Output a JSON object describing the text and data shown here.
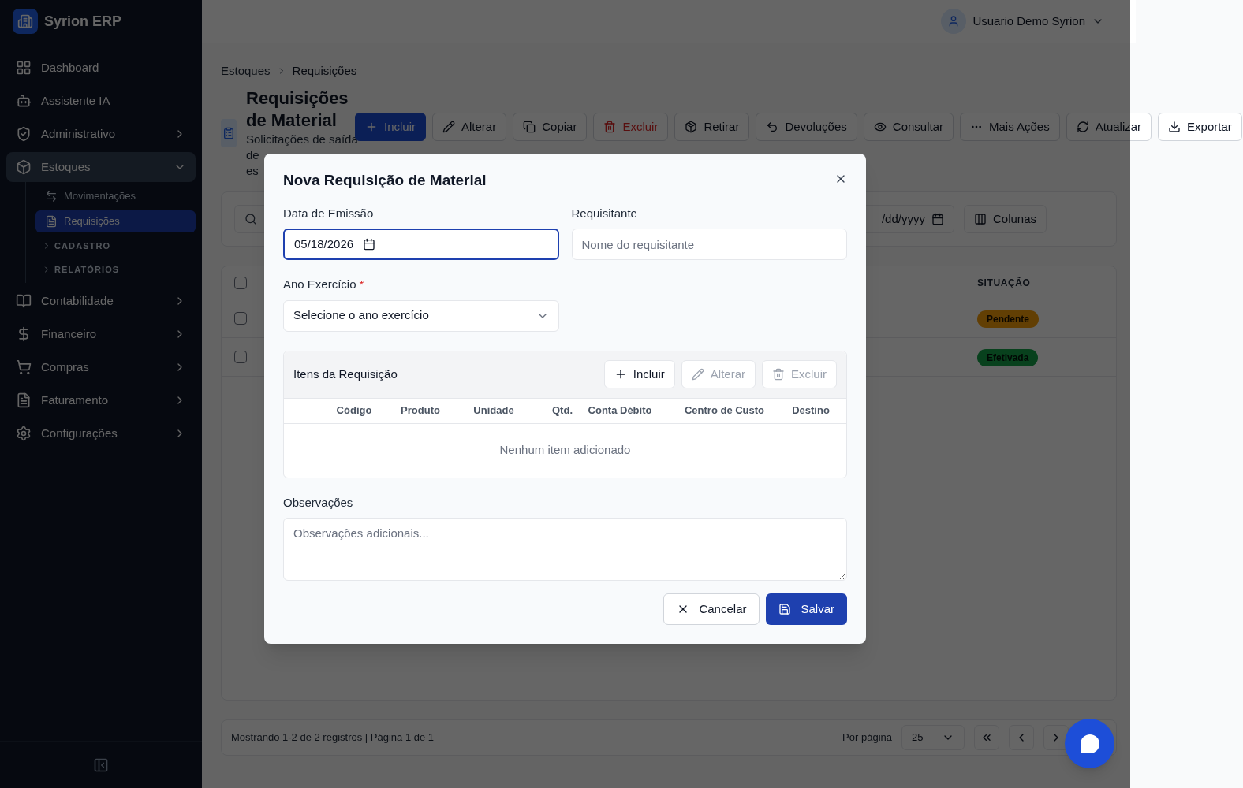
{
  "app": {
    "name": "Syrion ERP"
  },
  "sidebar": {
    "items": [
      {
        "label": "Dashboard",
        "expanded": false
      },
      {
        "label": "Assistente IA",
        "expanded": false
      },
      {
        "label": "Administrativo",
        "expanded": false
      },
      {
        "label": "Estoques",
        "expanded": true,
        "children": [
          {
            "label": "Movimentações",
            "kind": "link",
            "selected": false
          },
          {
            "label": "Requisições",
            "kind": "link",
            "selected": true
          },
          {
            "label": "CADASTRO",
            "kind": "section"
          },
          {
            "label": "RELATÓRIOS",
            "kind": "section"
          }
        ]
      },
      {
        "label": "Contabilidade",
        "expanded": false
      },
      {
        "label": "Financeiro",
        "expanded": false
      },
      {
        "label": "Compras",
        "expanded": false
      },
      {
        "label": "Faturamento",
        "expanded": false
      },
      {
        "label": "Configurações",
        "expanded": false
      }
    ]
  },
  "header": {
    "user": "Usuario Demo Syrion"
  },
  "breadcrumb": [
    "Estoques",
    "Requisições"
  ],
  "page": {
    "title_lines": [
      "Requisições",
      "de Material"
    ],
    "subtitle_lines": [
      "Solicitações de saída",
      "de",
      "es"
    ]
  },
  "toolbar": [
    {
      "label": "Incluir",
      "kind": "primary"
    },
    {
      "label": "Alterar",
      "kind": "default"
    },
    {
      "label": "Copiar",
      "kind": "default"
    },
    {
      "label": "Excluir",
      "kind": "danger"
    },
    {
      "label": "Retirar",
      "kind": "default"
    },
    {
      "label": "Devoluções",
      "kind": "default"
    },
    {
      "label": "Consultar",
      "kind": "default"
    },
    {
      "label": "Mais Ações",
      "kind": "default"
    },
    {
      "label": "Atualizar",
      "kind": "default"
    },
    {
      "label": "Exportar",
      "kind": "default"
    }
  ],
  "filters": {
    "date_value": "/dd/yyyy",
    "columns_button": "Colunas"
  },
  "table": {
    "status_header": "SITUAÇÃO",
    "header_checked": false,
    "rows": [
      {
        "checked": false,
        "status": "Pendente",
        "kind": "pending"
      },
      {
        "checked": false,
        "status": "Efetivada",
        "kind": "done"
      }
    ]
  },
  "footer": {
    "summary": "Mostrando 1-2 de 2 registros | Página 1 de 1",
    "per_page_label": "Por página",
    "per_page": "25"
  },
  "dialog": {
    "title": "Nova Requisição de Material",
    "date_label": "Data de Emissão",
    "date_value": "05/18/2026",
    "requester_label": "Requisitante",
    "requester_placeholder": "Nome do requisitante",
    "year_label": "Ano Exercício",
    "required_mark": "*",
    "year_placeholder": "Selecione o ano exercício",
    "items": {
      "title": "Itens da Requisição",
      "buttons": [
        {
          "label": "Incluir",
          "disabled": false
        },
        {
          "label": "Alterar",
          "disabled": true
        },
        {
          "label": "Excluir",
          "disabled": true
        }
      ],
      "columns": [
        "Código",
        "Produto",
        "Unidade",
        "Qtd.",
        "Conta Débito",
        "Centro de Custo",
        "Destino"
      ],
      "empty": "Nenhum item adicionado"
    },
    "notes_label": "Observações",
    "notes_placeholder": "Observações adicionais...",
    "cancel": "Cancelar",
    "save": "Salvar"
  }
}
